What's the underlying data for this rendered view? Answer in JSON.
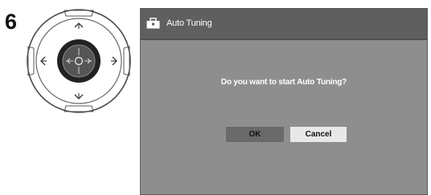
{
  "step": {
    "number": "6"
  },
  "remote": {
    "icons": [
      "arrow-up-icon",
      "arrow-down-icon",
      "arrow-left-icon",
      "arrow-right-icon",
      "enter-icon"
    ],
    "highlight_color": "#222222"
  },
  "dialog": {
    "title": "Auto Tuning",
    "title_icon": "toolbox-icon",
    "question": "Do you want to start Auto Tuning?",
    "buttons": {
      "ok_label": "OK",
      "cancel_label": "Cancel"
    },
    "colors": {
      "background": "#8e8e8e",
      "title_bar": "#5f5f5f",
      "selected_button": "#6a6a6a",
      "unselected_button": "#e8e8e8"
    }
  }
}
